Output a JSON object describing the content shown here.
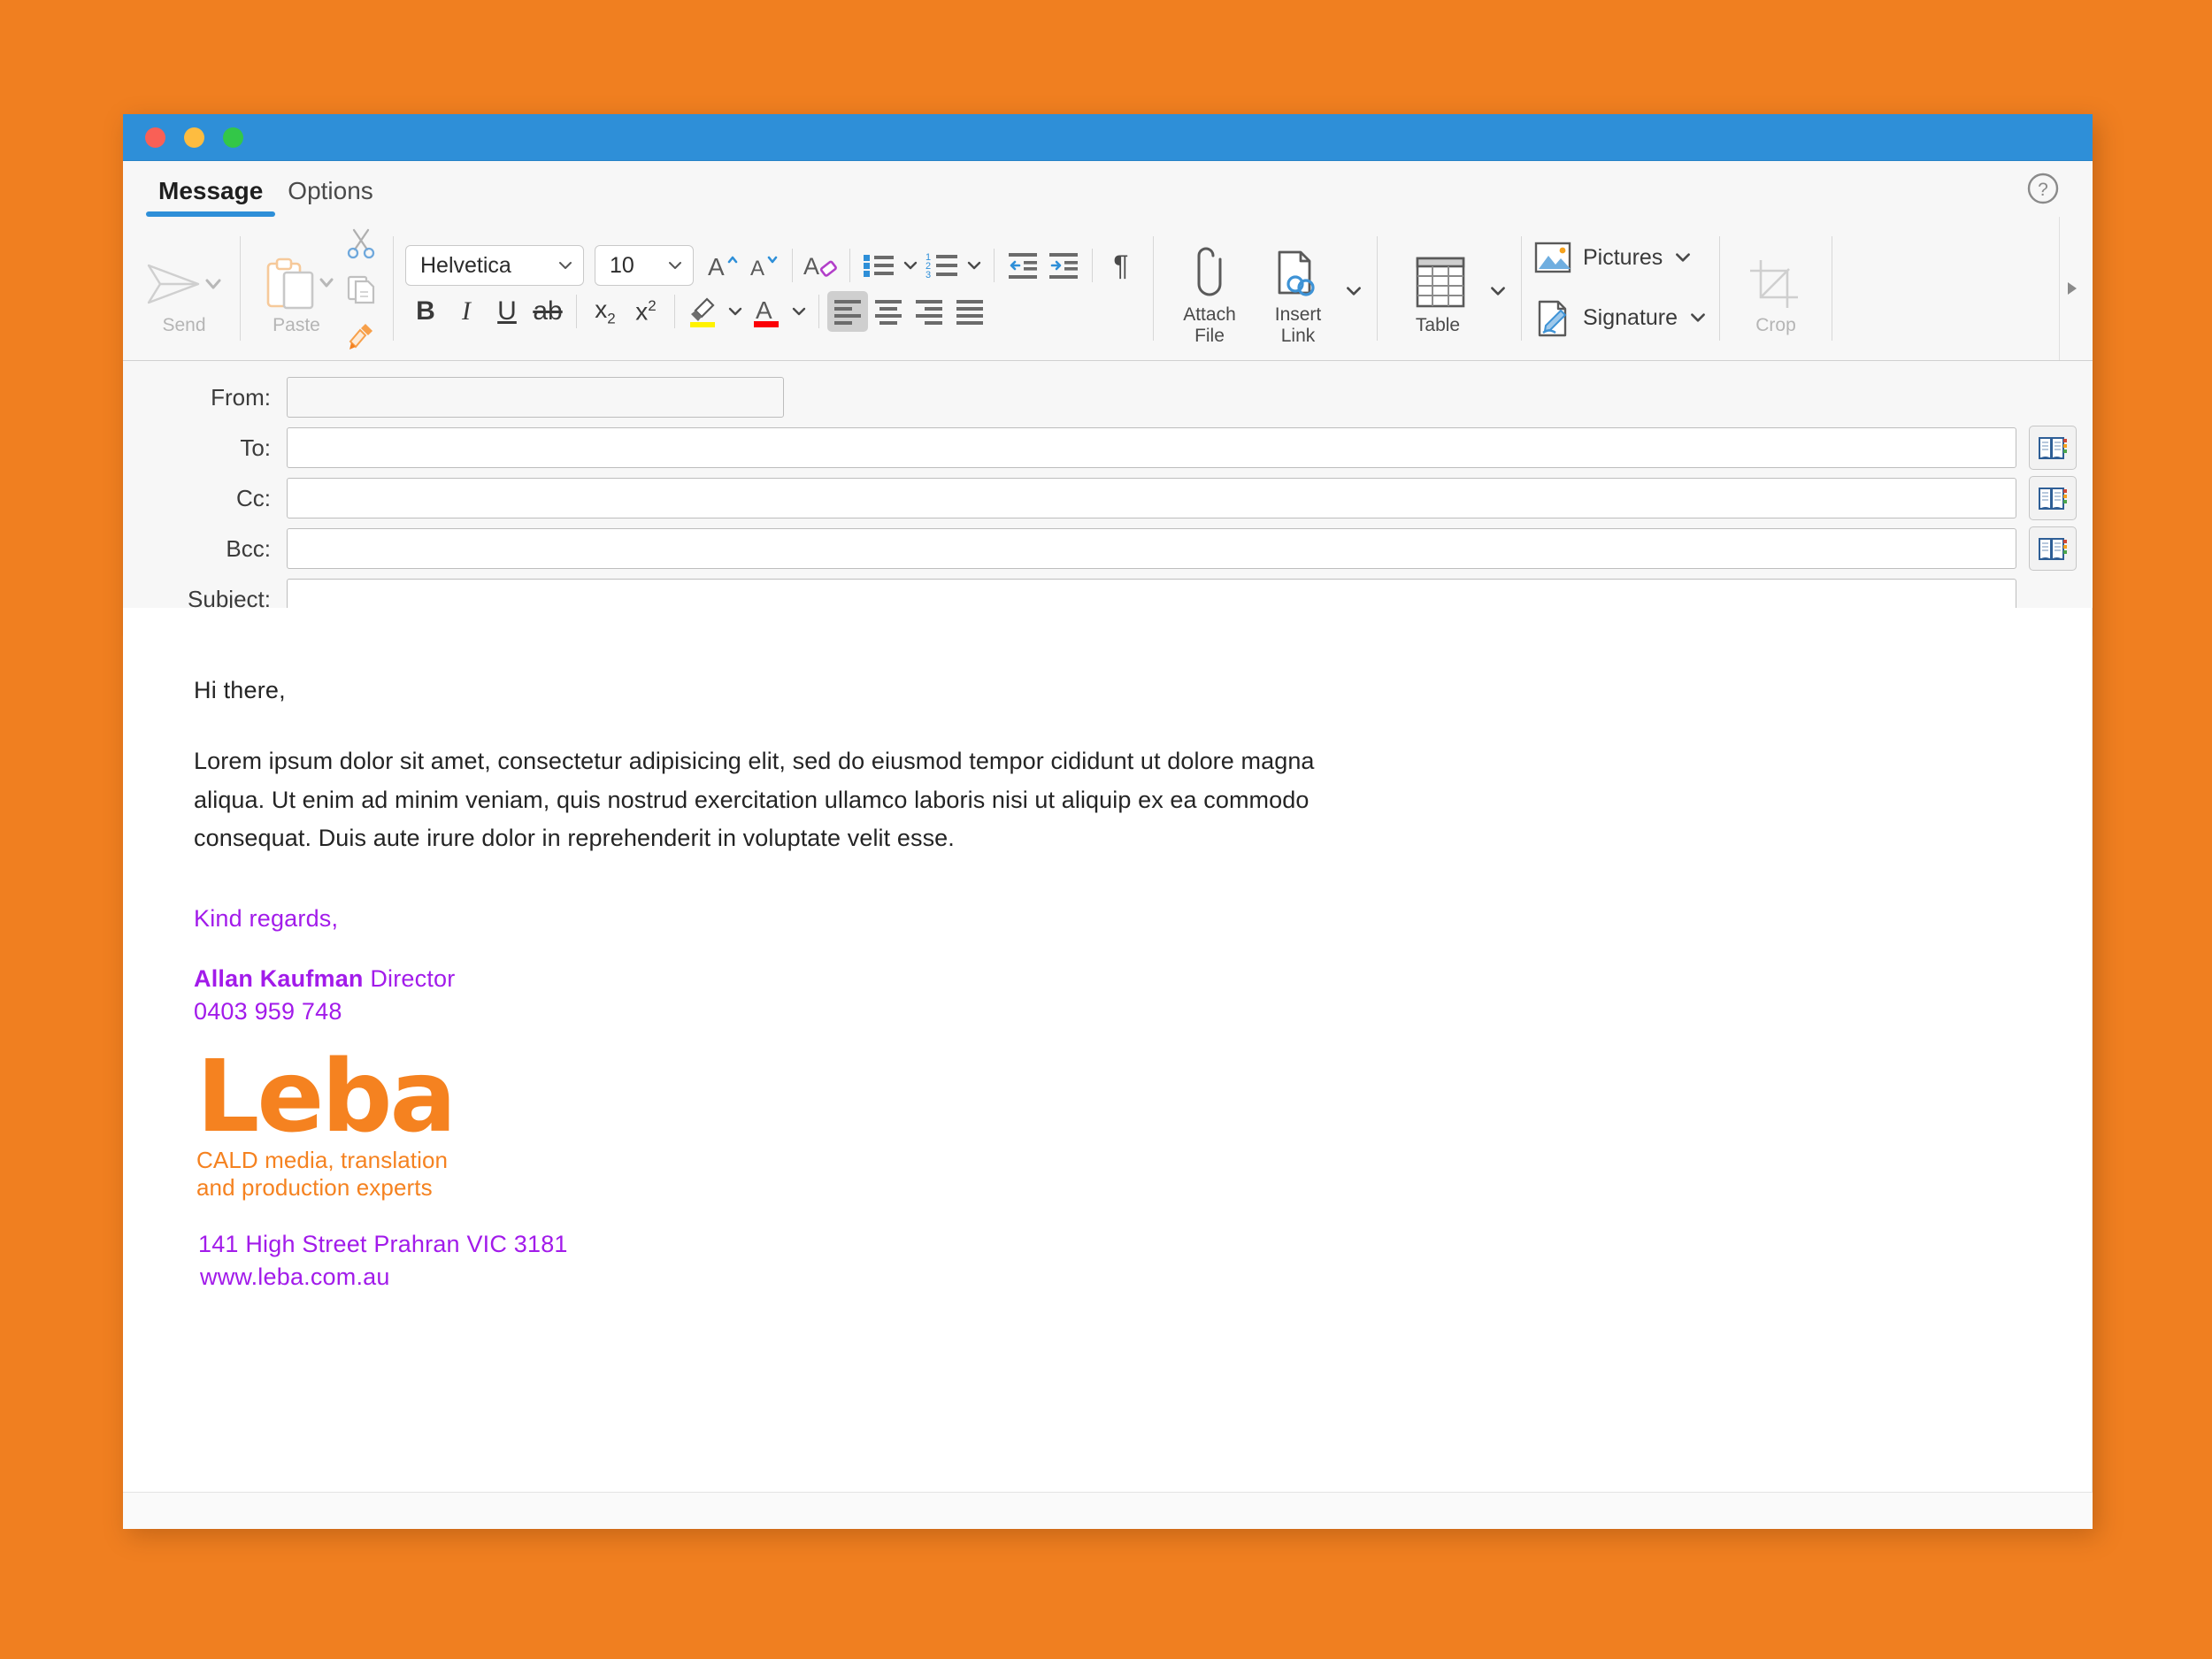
{
  "window": {
    "traffic_lights": [
      "close",
      "minimize",
      "zoom"
    ],
    "titlebar_color": "#2E8FD8"
  },
  "tabs": [
    {
      "label": "Message",
      "active": true
    },
    {
      "label": "Options",
      "active": false
    }
  ],
  "help": {
    "icon": "help-circle-icon"
  },
  "ribbon": {
    "send": {
      "label": "Send",
      "icon": "send-paper-plane-icon",
      "disabled": true
    },
    "paste": {
      "label": "Paste",
      "icon": "clipboard-icon"
    },
    "cut": {
      "icon": "scissors-icon"
    },
    "copy": {
      "icon": "copy-icon"
    },
    "format_painter": {
      "icon": "format-painter-icon"
    },
    "font_name": {
      "value": "Helvetica"
    },
    "font_size": {
      "value": "10"
    },
    "grow_font": {
      "icon": "grow-font-icon"
    },
    "shrink_font": {
      "icon": "shrink-font-icon"
    },
    "clear_formatting": {
      "icon": "clear-formatting-icon"
    },
    "bold": {
      "label": "B"
    },
    "italic": {
      "label": "I"
    },
    "underline": {
      "label": "U"
    },
    "strikethrough": {
      "label": "ab"
    },
    "subscript": {
      "label": "x",
      "script": "2"
    },
    "superscript": {
      "label": "x",
      "script": "2"
    },
    "highlight": {
      "icon": "highlighter-icon",
      "color": "#FFF200"
    },
    "font_color": {
      "icon": "font-color-icon",
      "color": "#FB0007"
    },
    "bullets": {
      "icon": "bulleted-list-icon"
    },
    "numbering": {
      "icon": "numbered-list-icon"
    },
    "decrease_indent": {
      "icon": "decrease-indent-icon"
    },
    "increase_indent": {
      "icon": "increase-indent-icon"
    },
    "show_marks": {
      "icon": "pilcrow-icon",
      "label": "¶"
    },
    "align_left": {
      "icon": "align-left-icon",
      "active": true
    },
    "align_center": {
      "icon": "align-center-icon"
    },
    "align_right": {
      "icon": "align-right-icon"
    },
    "align_justify": {
      "icon": "align-justify-icon"
    },
    "attach_file": {
      "label_line1": "Attach",
      "label_line2": "File",
      "icon": "paperclip-icon"
    },
    "insert_link": {
      "label_line1": "Insert",
      "label_line2": "Link",
      "icon": "insert-link-icon"
    },
    "table": {
      "label": "Table",
      "icon": "table-icon"
    },
    "pictures": {
      "label": "Pictures",
      "icon": "picture-icon"
    },
    "signature": {
      "label": "Signature",
      "icon": "signature-icon"
    },
    "crop": {
      "label": "Crop",
      "icon": "crop-icon",
      "disabled": true
    },
    "overflow": {
      "icon": "expand-ribbon-arrow-icon"
    }
  },
  "headers": {
    "from": {
      "label": "From:",
      "value": "",
      "placeholder": ""
    },
    "to": {
      "label": "To:",
      "value": "",
      "placeholder": ""
    },
    "cc": {
      "label": "Cc:",
      "value": "",
      "placeholder": ""
    },
    "bcc": {
      "label": "Bcc:",
      "value": "",
      "placeholder": ""
    },
    "subject": {
      "label": "Subject:",
      "value": "",
      "placeholder": ""
    },
    "address_book_icon": "address-book-icon"
  },
  "message": {
    "greeting": "Hi there,",
    "paragraph": "Lorem ipsum dolor sit amet, consectetur adipisicing elit, sed do eiusmod tempor cididunt ut dolore magna aliqua. Ut enim ad minim veniam, quis nostrud exercitation ullamco laboris nisi ut aliquip ex ea commodo consequat. Duis aute irure dolor in reprehenderit in voluptate velit esse."
  },
  "signature": {
    "regards": "Kind regards,",
    "name": "Allan Kaufman",
    "title": "Director",
    "phone": "0403 959 748",
    "logo_text": "Leba",
    "tagline_line1": "CALD media, translation",
    "tagline_line2": "and production experts",
    "address": "141 High Street Prahran VIC 3181",
    "website": "www.leba.com.au",
    "purple": "#A21BEA",
    "orange": "#F58220"
  },
  "theme": {
    "desktop_background": "#F07F20",
    "ribbon_background": "#F7F7F7",
    "accent": "#2E8FD8"
  }
}
